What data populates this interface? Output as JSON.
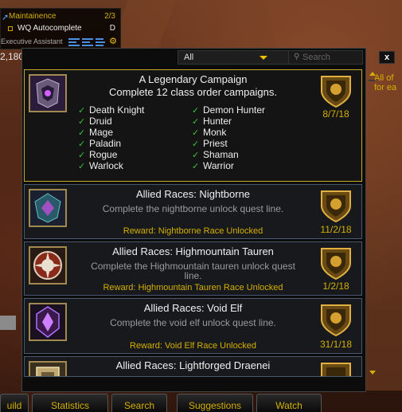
{
  "tracker": {
    "quest_title": "Maintainence",
    "quest_count": "2/3",
    "wq_label": "WQ Autocomplete",
    "wq_difficulty": "D",
    "assistant_label": "Executive Assistant"
  },
  "left_counter": "2,180",
  "filter": {
    "selected": "All"
  },
  "search": {
    "placeholder": "Search"
  },
  "close_label": "x",
  "side_text": {
    "line1": "All of",
    "line2": "for ea"
  },
  "colors": {
    "gold": "#d4b000",
    "check_green": "#36c236",
    "card_border": "#4a5a6e",
    "selected_border": "#c9a92a"
  },
  "achievements": [
    {
      "title": "A Legendary Campaign",
      "description": "Complete 12 class order campaigns.",
      "date": "8/7/18",
      "icon": "helmet-icon",
      "criteria_left": [
        "Death Knight",
        "Druid",
        "Mage",
        "Paladin",
        "Rogue",
        "Warlock"
      ],
      "criteria_right": [
        "Demon Hunter",
        "Hunter",
        "Monk",
        "Priest",
        "Shaman",
        "Warrior"
      ]
    },
    {
      "title": "Allied Races: Nightborne",
      "description": "Complete the nightborne unlock quest line.",
      "reward": "Reward: Nightborne Race Unlocked",
      "date": "11/2/18",
      "icon": "nightborne-crest-icon"
    },
    {
      "title": "Allied Races: Highmountain Tauren",
      "description": "Complete the Highmountain tauren unlock quest line.",
      "reward": "Reward: Highmountain Tauren Race Unlocked",
      "date": "1/2/18",
      "icon": "tauren-crest-icon"
    },
    {
      "title": "Allied Races: Void Elf",
      "description": "Complete the void elf unlock quest line.",
      "reward": "Reward: Void Elf Race Unlocked",
      "date": "31/1/18",
      "icon": "void-elf-crest-icon"
    },
    {
      "title": "Allied Races: Lightforged Draenei",
      "icon": "lightforged-crest-icon"
    }
  ],
  "tabs": [
    "uild",
    "Statistics",
    "Search",
    "Suggestions",
    "Watch"
  ]
}
